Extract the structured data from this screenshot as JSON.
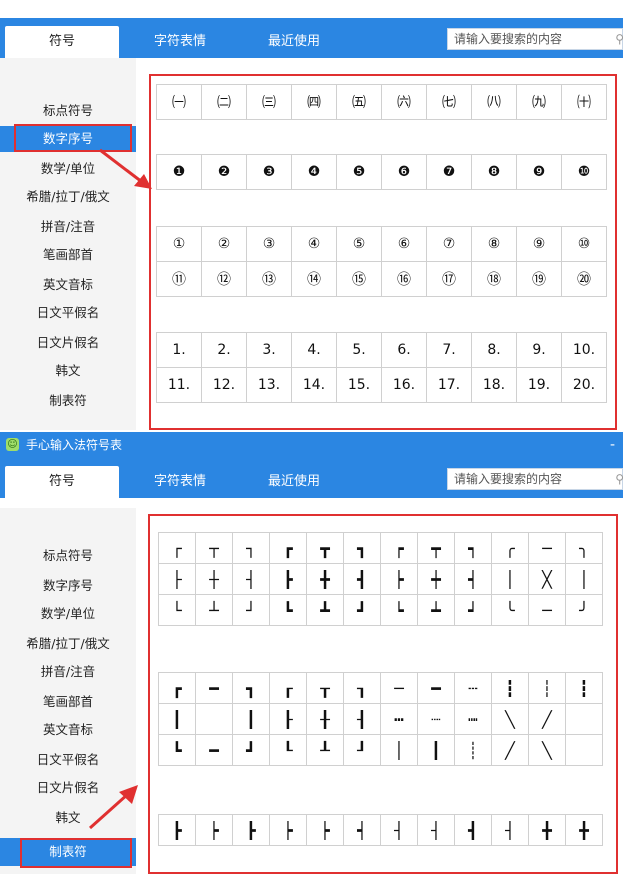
{
  "tabs": {
    "symbols": "符号",
    "emoticons": "字符表情",
    "recent": "最近使用"
  },
  "search": {
    "placeholder": "请输入要搜索的内容"
  },
  "title": "手心输入法符号表",
  "minimize": "-",
  "sidebar_items": [
    "标点符号",
    "数字序号",
    "数学/单位",
    "希腊/拉丁/俄文",
    "拼音/注音",
    "笔画部首",
    "英文音标",
    "日文平假名",
    "日文片假名",
    "韩文",
    "制表符"
  ],
  "panel1": {
    "selected": "数字序号",
    "rows": [
      [
        "㈠",
        "㈡",
        "㈢",
        "㈣",
        "㈤",
        "㈥",
        "㈦",
        "㈧",
        "㈨",
        "㈩"
      ],
      [
        "❶",
        "❷",
        "❸",
        "❹",
        "❺",
        "❻",
        "❼",
        "❽",
        "❾",
        "❿"
      ],
      [
        "①",
        "②",
        "③",
        "④",
        "⑤",
        "⑥",
        "⑦",
        "⑧",
        "⑨",
        "⑩"
      ],
      [
        "⑪",
        "⑫",
        "⑬",
        "⑭",
        "⑮",
        "⑯",
        "⑰",
        "⑱",
        "⑲",
        "⑳"
      ],
      [
        "1.",
        "2.",
        "3.",
        "4.",
        "5.",
        "6.",
        "7.",
        "8.",
        "9.",
        "10."
      ],
      [
        "11.",
        "12.",
        "13.",
        "14.",
        "15.",
        "16.",
        "17.",
        "18.",
        "19.",
        "20."
      ]
    ]
  },
  "panel2": {
    "selected": "制表符",
    "rows": [
      [
        "┌",
        "┬",
        "┐",
        "┏",
        "┳",
        "┓",
        "┍",
        "┯",
        "┑",
        "╭",
        "─",
        "╮"
      ],
      [
        "├",
        "┼",
        "┤",
        "┣",
        "╋",
        "┫",
        "┝",
        "┿",
        "┥",
        "│",
        "╳",
        "│"
      ],
      [
        "└",
        "┴",
        "┘",
        "┗",
        "┻",
        "┛",
        "┕",
        "┷",
        "┙",
        "╰",
        "─",
        "╯"
      ],
      [
        "┏",
        "━",
        "┓",
        "┎",
        "┰",
        "┒",
        "─",
        "━",
        "┄",
        "┇",
        "┆",
        "┇"
      ],
      [
        "┃",
        "",
        "┃",
        "┠",
        "╂",
        "┨",
        "┅",
        "┈",
        "┉",
        "╲",
        "╱",
        ""
      ],
      [
        "┗",
        "━",
        "┛",
        "┖",
        "┸",
        "┚",
        "│",
        "┃",
        "┊",
        "╱",
        "╲",
        ""
      ],
      [
        "┣",
        "┝",
        "┣",
        "┝",
        "┝",
        "┥",
        "┤",
        "┤",
        "┫",
        "┤",
        "╋",
        "╋"
      ]
    ]
  },
  "colors": {
    "accent": "#2b86e2",
    "highlight": "#e03030"
  }
}
